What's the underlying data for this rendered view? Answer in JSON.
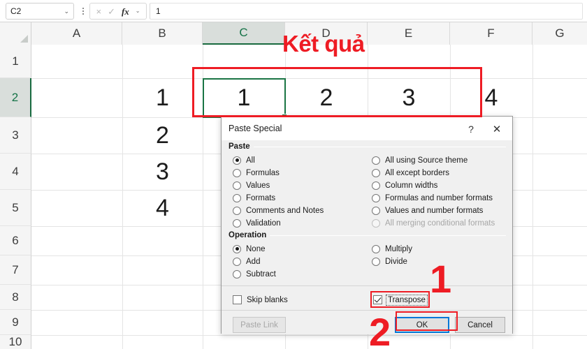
{
  "formula_bar": {
    "name_box_value": "C2",
    "name_box_chevron": "chevron-down-icon",
    "kebab": "more-options-icon",
    "cancel_icon": "×",
    "enter_icon": "✓",
    "function_icon": "fx",
    "function_chevron": "⌄",
    "formula_value": "1"
  },
  "grid": {
    "columns": [
      "A",
      "B",
      "C",
      "D",
      "E",
      "F",
      "G"
    ],
    "active_column": "C",
    "rows": [
      "1",
      "2",
      "3",
      "4",
      "5",
      "6",
      "7",
      "8",
      "9",
      "10"
    ],
    "active_row": "2",
    "source_cells": [
      {
        "ref": "B2",
        "value": "1"
      },
      {
        "ref": "B3",
        "value": "2"
      },
      {
        "ref": "B4",
        "value": "3"
      },
      {
        "ref": "B5",
        "value": "4"
      }
    ],
    "result_cells": [
      {
        "ref": "C2",
        "value": "1"
      },
      {
        "ref": "D2",
        "value": "2"
      },
      {
        "ref": "E2",
        "value": "3"
      },
      {
        "ref": "F2",
        "value": "4"
      }
    ],
    "active_cell": "C2"
  },
  "annotations": {
    "result_label": "Kết quả",
    "step_one": "1",
    "step_two": "2",
    "color": "#ee1c24"
  },
  "dialog": {
    "title": "Paste Special",
    "help_icon": "?",
    "close_icon": "✕",
    "paste_group_label": "Paste",
    "paste_left_options": [
      {
        "label": "All",
        "selected": true,
        "disabled": false,
        "accel": "A"
      },
      {
        "label": "Formulas",
        "selected": false,
        "disabled": false,
        "accel": "F"
      },
      {
        "label": "Values",
        "selected": false,
        "disabled": false,
        "accel": "V"
      },
      {
        "label": "Formats",
        "selected": false,
        "disabled": false,
        "accel": "t"
      },
      {
        "label": "Comments and Notes",
        "selected": false,
        "disabled": false,
        "accel": "C"
      },
      {
        "label": "Validation",
        "selected": false,
        "disabled": false,
        "accel": "n"
      }
    ],
    "paste_right_options": [
      {
        "label": "All using Source theme",
        "selected": false,
        "disabled": false,
        "accel": "h"
      },
      {
        "label": "All except borders",
        "selected": false,
        "disabled": false,
        "accel": "x"
      },
      {
        "label": "Column widths",
        "selected": false,
        "disabled": false,
        "accel": "w"
      },
      {
        "label": "Formulas and number formats",
        "selected": false,
        "disabled": false,
        "accel": "r"
      },
      {
        "label": "Values and number formats",
        "selected": false,
        "disabled": false,
        "accel": "u"
      },
      {
        "label": "All merging conditional formats",
        "selected": false,
        "disabled": true,
        "accel": "g"
      }
    ],
    "operation_group_label": "Operation",
    "operation_left_options": [
      {
        "label": "None",
        "selected": true,
        "disabled": false,
        "accel": "o"
      },
      {
        "label": "Add",
        "selected": false,
        "disabled": false,
        "accel": "d"
      },
      {
        "label": "Subtract",
        "selected": false,
        "disabled": false,
        "accel": "S"
      }
    ],
    "operation_right_options": [
      {
        "label": "Multiply",
        "selected": false,
        "disabled": false,
        "accel": "M"
      },
      {
        "label": "Divide",
        "selected": false,
        "disabled": false,
        "accel": "i"
      }
    ],
    "skip_blanks": {
      "label": "Skip blanks",
      "checked": false,
      "accel": "b"
    },
    "transpose": {
      "label": "Transpose",
      "checked": true,
      "accel": "e"
    },
    "paste_link_button": "Paste Link",
    "ok_button": "OK",
    "cancel_button": "Cancel"
  }
}
